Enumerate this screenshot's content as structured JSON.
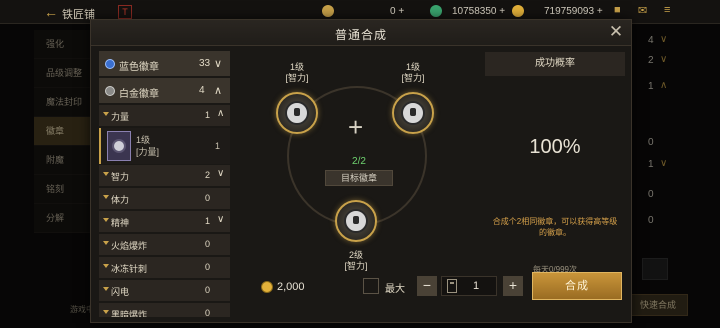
{
  "topbar": {
    "back_glyph": "←",
    "title": "铁匠铺",
    "red_icon_glyph": "T",
    "res1_plus": "0 +",
    "res2_value": "10758350 +",
    "res3_value": "719759093 +"
  },
  "left_menu": {
    "items": [
      {
        "label": "强化"
      },
      {
        "label": "品级调整"
      },
      {
        "label": "魔法封印"
      },
      {
        "label": "徽章"
      },
      {
        "label": "附魔"
      },
      {
        "label": "铭刻"
      },
      {
        "label": "分解"
      }
    ],
    "bottom_text": "游戏中"
  },
  "right_column": {
    "rows": [
      {
        "count": "4",
        "chevron": "∨"
      },
      {
        "count": "2",
        "chevron": "∨"
      },
      {
        "count": "1",
        "chevron": "∧"
      },
      {
        "count": "0",
        "chevron": ""
      },
      {
        "count": "1",
        "chevron": "∨"
      },
      {
        "count": "0",
        "chevron": ""
      },
      {
        "count": "0",
        "chevron": ""
      }
    ],
    "quick_button": "快速合成"
  },
  "modal": {
    "title": "普通合成",
    "close_glyph": "✕",
    "list": {
      "categories": [
        {
          "label": "蓝色徽章",
          "count": "33",
          "chevron": "∨",
          "color": "#3a6fd0"
        },
        {
          "label": "白金徽章",
          "count": "4",
          "chevron": "∧",
          "color": "#8a8a88"
        }
      ],
      "power": {
        "label": "力量",
        "count": "1",
        "chevron": "∧"
      },
      "item": {
        "level": "1级",
        "tag": "[力量]",
        "count": "1"
      },
      "subs": [
        {
          "label": "智力",
          "count": "2",
          "chevron": "∨"
        },
        {
          "label": "体力",
          "count": "0",
          "chevron": ""
        },
        {
          "label": "精神",
          "count": "1",
          "chevron": "∨"
        },
        {
          "label": "火焰爆炸",
          "count": "0",
          "chevron": ""
        },
        {
          "label": "冰冻针刺",
          "count": "0",
          "chevron": ""
        },
        {
          "label": "闪电",
          "count": "0",
          "chevron": ""
        },
        {
          "label": "黑暗爆炸",
          "count": "0",
          "chevron": ""
        }
      ]
    },
    "synthesis": {
      "slot1": {
        "level": "1级",
        "tag": "[智力]"
      },
      "slot2": {
        "level": "1级",
        "tag": "[智力]"
      },
      "plus_glyph": "+",
      "progress": "2/2",
      "target_label": "目标徽章",
      "result": {
        "level": "2级",
        "tag": "[智力]"
      }
    },
    "info": {
      "header": "成功概率",
      "rate": "100%",
      "desc": "合成个2相同徽章，可以获得高等级的徽章。",
      "daily": "每天0/999次"
    },
    "controls": {
      "cost": "2,000",
      "max_label": "最大",
      "minus": "−",
      "quantity": "1",
      "plus": "+",
      "synth_button": "合成"
    }
  },
  "colors": {
    "accent_gold": "#c9a24a",
    "progress_green": "#6fd36f",
    "desc_orange": "#d6a14a",
    "blue_badge": "#3a6fd0"
  }
}
